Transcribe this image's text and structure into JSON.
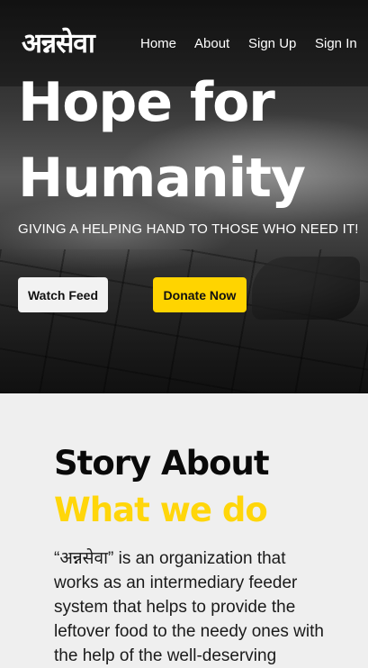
{
  "nav": {
    "logo": "अन्नसेवा",
    "links": [
      "Home",
      "About",
      "Sign Up",
      "Sign In"
    ]
  },
  "hero": {
    "title_line1": "Hope for",
    "title_line2": "Humanity",
    "tagline": "GIVING A HELPING HAND TO THOSE WHO NEED IT!",
    "watch_label": "Watch Feed",
    "donate_label": "Donate Now"
  },
  "about": {
    "heading": "Story About",
    "subheading": "What we do",
    "body": "“अन्नसेवा” is an organization that works as an intermediary feeder system that helps to provide the leftover food to the needy ones with the help of the well-deserving"
  },
  "colors": {
    "accent": "#ffd400",
    "dark": "#0a0a0a",
    "section_bg": "#efefef"
  }
}
